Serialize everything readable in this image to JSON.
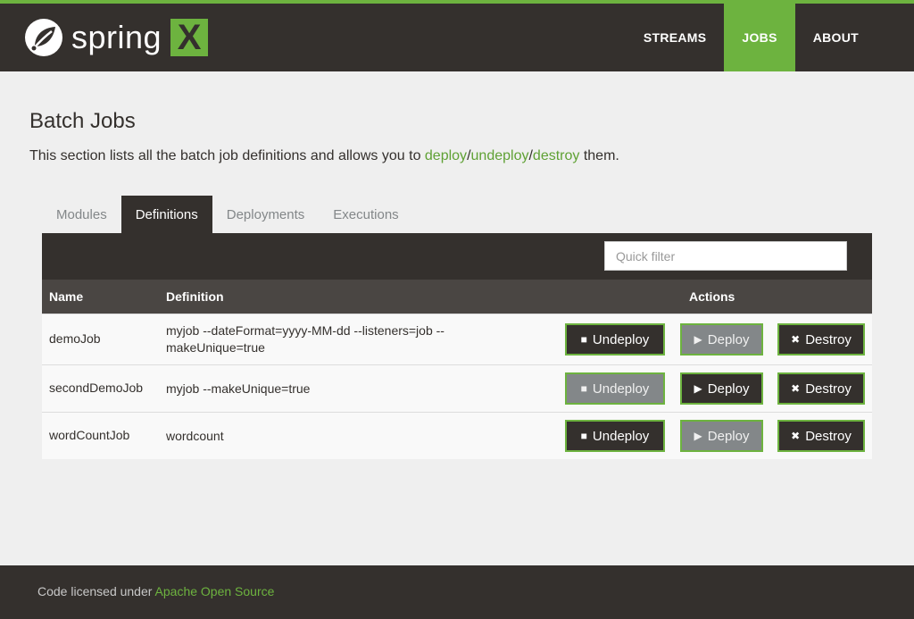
{
  "header": {
    "logo_text": "spring",
    "logo_x": "X",
    "nav": [
      {
        "label": "STREAMS",
        "active": false
      },
      {
        "label": "JOBS",
        "active": true
      },
      {
        "label": "ABOUT",
        "active": false
      }
    ]
  },
  "page": {
    "title": "Batch Jobs",
    "intro_prefix": "This section lists all the batch job definitions and allows you to ",
    "intro_link_deploy": "deploy",
    "intro_sep1": "/",
    "intro_link_undeploy": "undeploy",
    "intro_sep2": "/",
    "intro_link_destroy": "destroy",
    "intro_suffix": " them."
  },
  "tabs": [
    {
      "label": "Modules",
      "active": false
    },
    {
      "label": "Definitions",
      "active": true
    },
    {
      "label": "Deployments",
      "active": false
    },
    {
      "label": "Executions",
      "active": false
    }
  ],
  "filter": {
    "placeholder": "Quick filter",
    "value": ""
  },
  "table": {
    "headers": {
      "name": "Name",
      "definition": "Definition",
      "actions": "Actions"
    },
    "buttons": {
      "undeploy": "Undeploy",
      "deploy": "Deploy",
      "destroy": "Destroy"
    },
    "rows": [
      {
        "name": "demoJob",
        "definition": "myjob --dateFormat=yyyy-MM-dd --listeners=job --makeUnique=true",
        "undeploy_enabled": true,
        "deploy_enabled": false
      },
      {
        "name": "secondDemoJob",
        "definition": "myjob --makeUnique=true",
        "undeploy_enabled": false,
        "deploy_enabled": true
      },
      {
        "name": "wordCountJob",
        "definition": "wordcount",
        "undeploy_enabled": true,
        "deploy_enabled": false
      }
    ]
  },
  "footer": {
    "prefix": "Code licensed under ",
    "link": "Apache Open Source"
  },
  "colors": {
    "brand_green": "#6db33f",
    "dark": "#34302d",
    "disabled": "#838789"
  }
}
